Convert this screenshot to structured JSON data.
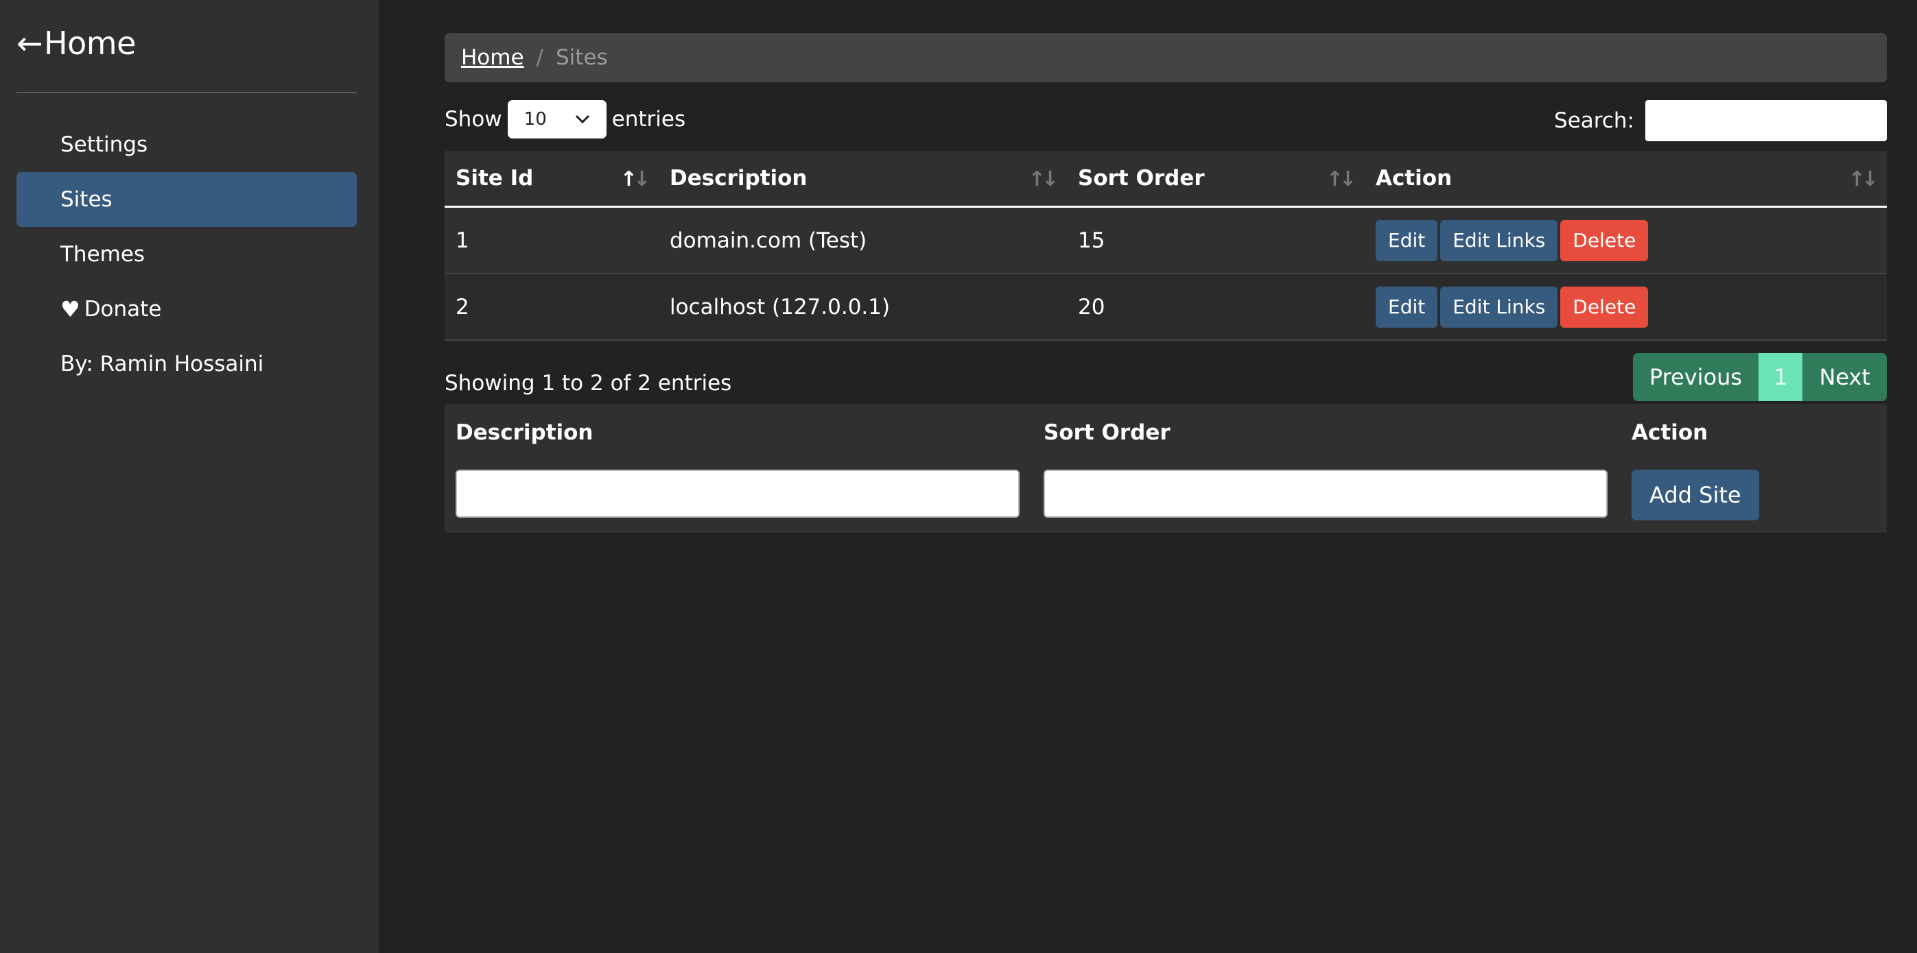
{
  "sidebar": {
    "home_arrow": "←",
    "home_label": "Home",
    "items": [
      {
        "label": "Settings",
        "active": false
      },
      {
        "label": "Sites",
        "active": true
      },
      {
        "label": "Themes",
        "active": false
      },
      {
        "label": "Donate",
        "active": false,
        "icon": "heart-icon"
      },
      {
        "label": "By: Ramin Hossaini",
        "active": false
      }
    ]
  },
  "breadcrumb": {
    "home": "Home",
    "separator": "/",
    "current": "Sites"
  },
  "controls": {
    "show_label": "Show",
    "page_length": "10",
    "entries_label": "entries",
    "search_label": "Search:",
    "search_value": ""
  },
  "table": {
    "columns": [
      "Site Id",
      "Description",
      "Sort Order",
      "Action"
    ],
    "sorted_column": "Site Id",
    "sort_direction": "ascending",
    "rows": [
      {
        "site_id": "1",
        "description": "domain.com (Test)",
        "sort_order": "15"
      },
      {
        "site_id": "2",
        "description": "localhost (127.0.0.1)",
        "sort_order": "20"
      }
    ],
    "actions": {
      "edit": "Edit",
      "edit_links": "Edit Links",
      "delete": "Delete"
    }
  },
  "info": "Showing 1 to 2 of 2 entries",
  "pagination": {
    "previous": "Previous",
    "current_page": "1",
    "next": "Next"
  },
  "add_form": {
    "description_label": "Description",
    "sort_order_label": "Sort Order",
    "action_label": "Action",
    "description_value": "",
    "sort_order_value": "",
    "add_button": "Add Site"
  },
  "colors": {
    "accent": "#375a7f",
    "danger": "#e74c3c",
    "success": "#2f7b5a",
    "background": "#222222",
    "sidebar": "#303030"
  }
}
